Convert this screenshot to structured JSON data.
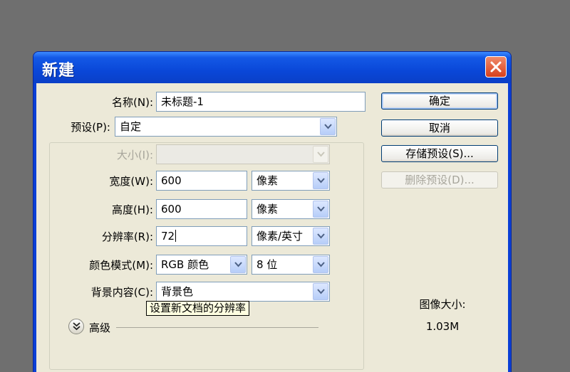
{
  "window": {
    "title": "新建"
  },
  "form": {
    "name": {
      "label": "名称(N):",
      "value": "未标题-1"
    },
    "preset": {
      "label": "预设(P):",
      "value": "自定"
    },
    "size": {
      "label": "大小(I):",
      "value": ""
    },
    "width": {
      "label": "宽度(W):",
      "value": "600",
      "unit": "像素"
    },
    "height": {
      "label": "高度(H):",
      "value": "600",
      "unit": "像素"
    },
    "resolution": {
      "label": "分辨率(R):",
      "value": "72",
      "unit": "像素/英寸"
    },
    "color_mode": {
      "label": "颜色模式(M):",
      "value": "RGB 颜色",
      "depth": "8 位"
    },
    "background": {
      "label": "背景内容(C):",
      "value": "背景色"
    },
    "advanced": {
      "label": "高级"
    }
  },
  "tooltip": {
    "text": "设置新文档的分辨率"
  },
  "buttons": {
    "ok": "确定",
    "cancel": "取消",
    "save_preset": "存储预设(S)...",
    "delete_preset": "删除预设(D)..."
  },
  "image_size": {
    "label": "图像大小:",
    "value": "1.03M"
  }
}
